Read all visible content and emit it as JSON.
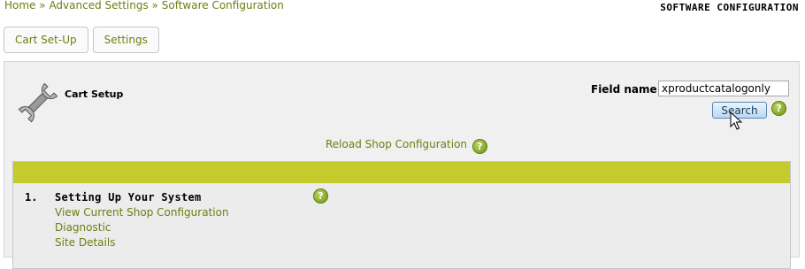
{
  "breadcrumb": {
    "items": [
      "Home",
      "Advanced Settings",
      "Software Configuration"
    ],
    "separator": "»"
  },
  "page_heading": "SOFTWARE CONFIGURATION",
  "tabs": [
    {
      "label": "Cart Set-Up"
    },
    {
      "label": "Settings"
    }
  ],
  "panel": {
    "title": "Cart Setup",
    "icon": "wrench-icon",
    "field_name_label": "Field name",
    "field_name_value": "xproductcatalogonly",
    "search_label": "Search",
    "reload_label": "Reload Shop Configuration"
  },
  "section": {
    "number": "1.",
    "title": "Setting Up Your System",
    "links": [
      "View Current Shop Configuration",
      "Diagnostic",
      "Site Details"
    ]
  },
  "colors": {
    "link": "#6b7f12",
    "header_bar": "#c5cb2d",
    "help_icon": "#8fb326"
  }
}
